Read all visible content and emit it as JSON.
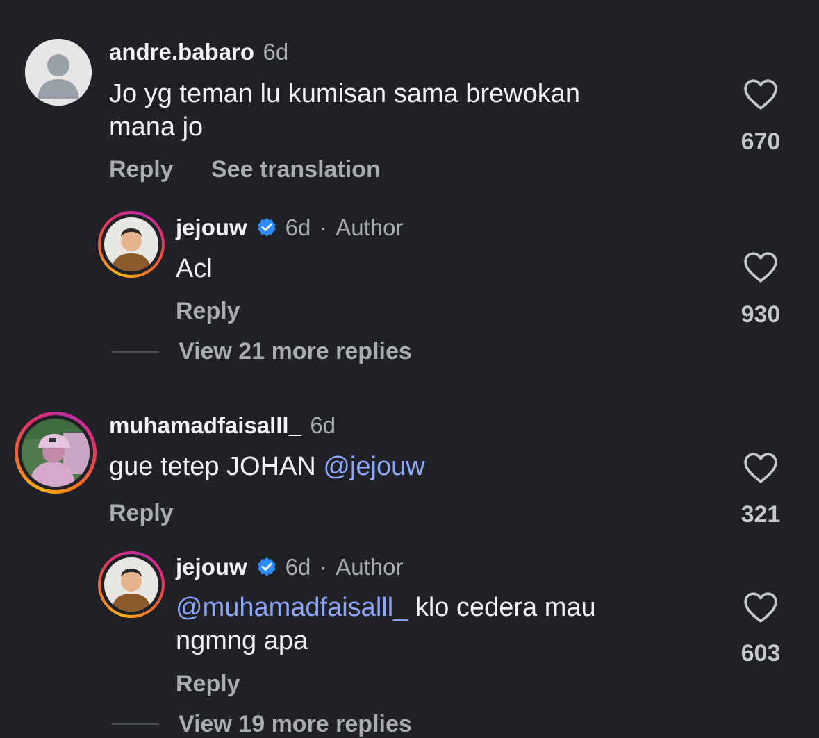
{
  "comments": [
    {
      "username": "andre.babaro",
      "time": "6d",
      "text_line1": "Jo yg teman lu kumisan sama brewokan",
      "text_line2": "mana jo",
      "reply_label": "Reply",
      "translate_label": "See translation",
      "likes": "670"
    },
    {
      "username": "jejouw",
      "time": "6d",
      "dot": "·",
      "author_label": "Author",
      "text": "Acl",
      "reply_label": "Reply",
      "likes": "930",
      "view_more": "View 21 more replies"
    },
    {
      "username": "muhamadfaisalll_",
      "time": "6d",
      "text": "gue tetep JOHAN ",
      "mention": "@jejouw",
      "reply_label": "Reply",
      "likes": "321"
    },
    {
      "username": "jejouw",
      "time": "6d",
      "dot": "·",
      "author_label": "Author",
      "mention": "@muhamadfaisalll_",
      "text_line1": " klo cedera mau",
      "text_line2": "ngmng apa",
      "reply_label": "Reply",
      "likes": "603",
      "view_more": "View 19 more replies"
    }
  ],
  "icons": {
    "like": "heart-outline-icon",
    "verified": "verified-badge-icon"
  },
  "colors": {
    "background": "#1f2125",
    "mention": "#8fa6ff",
    "verified": "#2f8cff"
  }
}
